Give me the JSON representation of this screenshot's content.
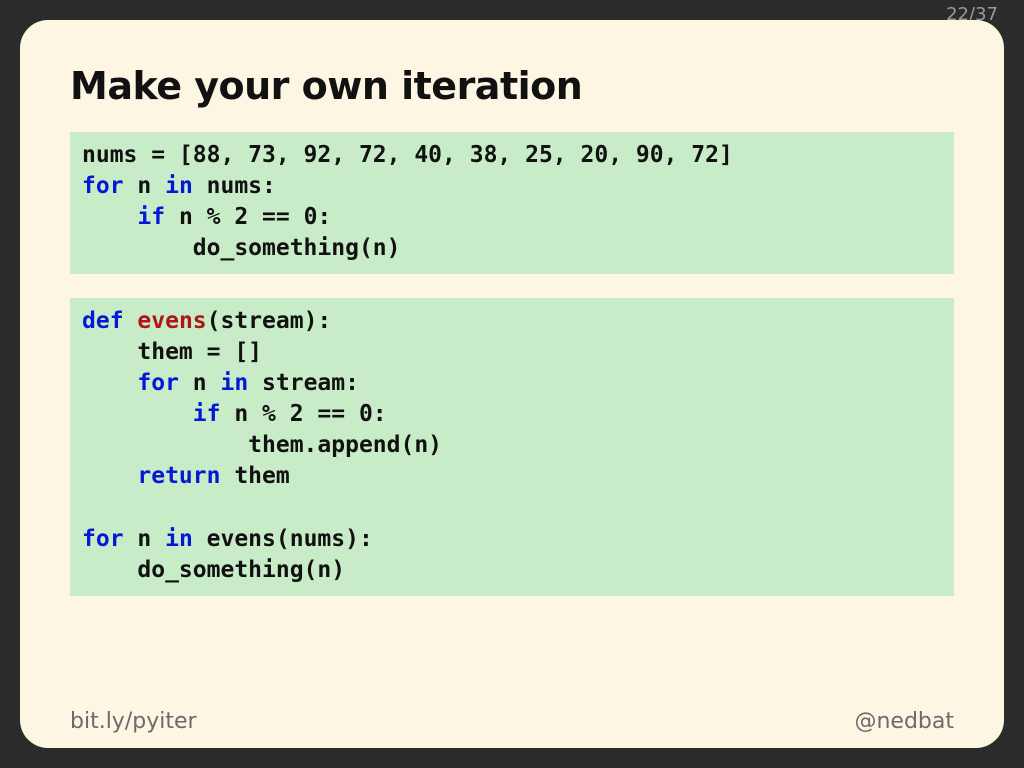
{
  "pager": {
    "current": "22",
    "sep": "/",
    "total": "37"
  },
  "title": "Make your own iteration",
  "code1": {
    "l1a": "nums = [88, 73, 92, 72, 40, 38, 25, 20, 90, 72]",
    "l2_kw1": "for",
    "l2_mid": " n ",
    "l2_kw2": "in",
    "l2_end": " nums:",
    "l3_kw": "if",
    "l3_end": " n % 2 == 0:",
    "l4": "        do_something(n)"
  },
  "code2": {
    "l1_kw": "def",
    "l1_sp": " ",
    "l1_fn": "evens",
    "l1_end": "(stream):",
    "l2": "    them = []",
    "l3_kw1": "for",
    "l3_mid": " n ",
    "l3_kw2": "in",
    "l3_end": " stream:",
    "l4_kw": "if",
    "l4_end": " n % 2 == 0:",
    "l5": "            them.append(n)",
    "l6_kw": "return",
    "l6_end": " them",
    "blank": "",
    "l8_kw1": "for",
    "l8_mid": " n ",
    "l8_kw2": "in",
    "l8_end": " evens(nums):",
    "l9": "    do_something(n)"
  },
  "footer": {
    "left_prefix": "bit.ly",
    "left_slash": "/",
    "left_suffix": "pyiter",
    "right": "@nedbat"
  }
}
